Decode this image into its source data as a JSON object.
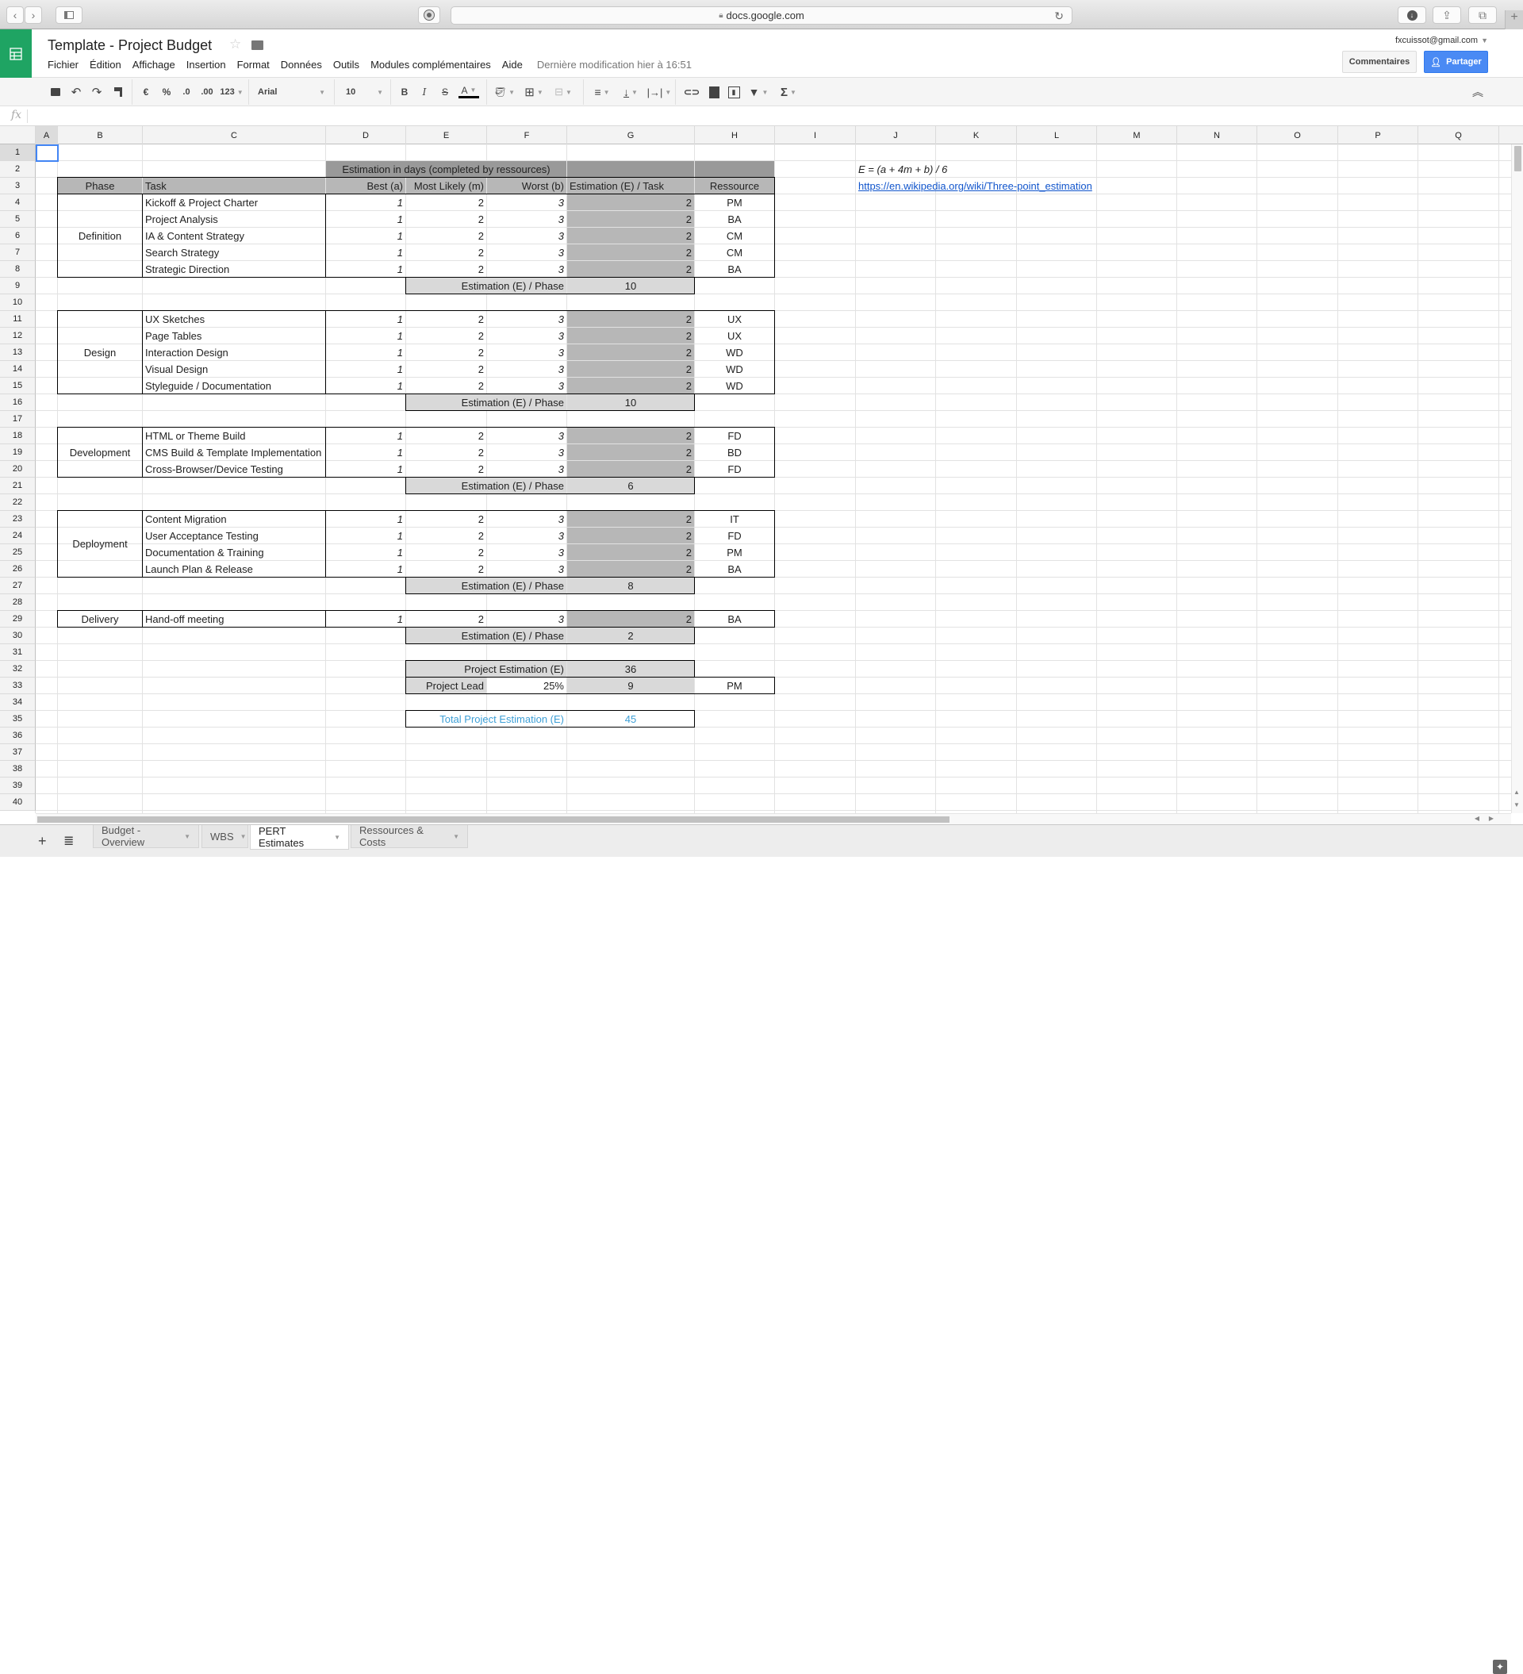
{
  "browser": {
    "address": "docs.google.com",
    "back_icon": "chevron-left-icon",
    "forward_icon": "chevron-right-icon"
  },
  "app": {
    "title": "Template - Project Budget",
    "menu": [
      "Fichier",
      "Édition",
      "Affichage",
      "Insertion",
      "Format",
      "Données",
      "Outils",
      "Modules complémentaires",
      "Aide"
    ],
    "last_modified": "Dernière modification hier à 16:51",
    "account": "fxcuissot@gmail.com",
    "comments_label": "Commentaires",
    "share_label": "Partager",
    "accent_color": "#4a8af4",
    "brand_color": "#1fa463"
  },
  "toolbar": {
    "currency": "€",
    "percent": "%",
    "decrease_decimals": ".0",
    "increase_decimals": ".00",
    "number_format": "123",
    "font": "Arial",
    "font_size": "10",
    "bold": "B",
    "italic": "I",
    "strike": "S",
    "text_color": "A",
    "sum": "Σ"
  },
  "formula_bar": {
    "fx": "fx",
    "value": ""
  },
  "columns": [
    "A",
    "B",
    "C",
    "D",
    "E",
    "F",
    "G",
    "H",
    "I",
    "J",
    "K",
    "L",
    "M",
    "N",
    "O",
    "P",
    "Q"
  ],
  "rows": [
    "1",
    "2",
    "3",
    "4",
    "5",
    "6",
    "7",
    "8",
    "9",
    "10",
    "11",
    "12",
    "13",
    "14",
    "15",
    "16",
    "17",
    "18",
    "19",
    "20",
    "21",
    "22",
    "23",
    "24",
    "25",
    "26",
    "27",
    "28",
    "29",
    "30",
    "31",
    "32",
    "33",
    "34",
    "35",
    "36",
    "37",
    "38",
    "39",
    "40"
  ],
  "sheet": {
    "group_header": "Estimation in days (completed by ressources)",
    "headers": {
      "phase": "Phase",
      "task": "Task",
      "best": "Best (a)",
      "likely": "Most Likely (m)",
      "worst": "Worst (b)",
      "estimation": "Estimation (E) / Task",
      "resource": "Ressource"
    },
    "formula": "E = (a + 4m + b) / 6",
    "link": "https://en.wikipedia.org/wiki/Three-point_estimation",
    "phase_total_label": "Estimation (E) / Phase",
    "phases": [
      {
        "name": "Definition",
        "total": "10",
        "tasks": [
          {
            "task": "Kickoff & Project Charter",
            "a": "1",
            "m": "2",
            "b": "3",
            "e": "2",
            "res": "PM"
          },
          {
            "task": "Project Analysis",
            "a": "1",
            "m": "2",
            "b": "3",
            "e": "2",
            "res": "BA"
          },
          {
            "task": "IA & Content Strategy",
            "a": "1",
            "m": "2",
            "b": "3",
            "e": "2",
            "res": "CM"
          },
          {
            "task": "Search Strategy",
            "a": "1",
            "m": "2",
            "b": "3",
            "e": "2",
            "res": "CM"
          },
          {
            "task": "Strategic Direction",
            "a": "1",
            "m": "2",
            "b": "3",
            "e": "2",
            "res": "BA"
          }
        ]
      },
      {
        "name": "Design",
        "total": "10",
        "tasks": [
          {
            "task": "UX Sketches",
            "a": "1",
            "m": "2",
            "b": "3",
            "e": "2",
            "res": "UX"
          },
          {
            "task": "Page Tables",
            "a": "1",
            "m": "2",
            "b": "3",
            "e": "2",
            "res": "UX"
          },
          {
            "task": "Interaction Design",
            "a": "1",
            "m": "2",
            "b": "3",
            "e": "2",
            "res": "WD"
          },
          {
            "task": "Visual Design",
            "a": "1",
            "m": "2",
            "b": "3",
            "e": "2",
            "res": "WD"
          },
          {
            "task": "Styleguide / Documentation",
            "a": "1",
            "m": "2",
            "b": "3",
            "e": "2",
            "res": "WD"
          }
        ]
      },
      {
        "name": "Development",
        "total": "6",
        "tasks": [
          {
            "task": "HTML or Theme Build",
            "a": "1",
            "m": "2",
            "b": "3",
            "e": "2",
            "res": "FD"
          },
          {
            "task": "CMS Build & Template Implementation",
            "a": "1",
            "m": "2",
            "b": "3",
            "e": "2",
            "res": "BD"
          },
          {
            "task": "Cross-Browser/Device Testing",
            "a": "1",
            "m": "2",
            "b": "3",
            "e": "2",
            "res": "FD"
          }
        ]
      },
      {
        "name": "Deployment",
        "total": "8",
        "tasks": [
          {
            "task": "Content Migration",
            "a": "1",
            "m": "2",
            "b": "3",
            "e": "2",
            "res": "IT"
          },
          {
            "task": "User Acceptance Testing",
            "a": "1",
            "m": "2",
            "b": "3",
            "e": "2",
            "res": "FD"
          },
          {
            "task": "Documentation & Training",
            "a": "1",
            "m": "2",
            "b": "3",
            "e": "2",
            "res": "PM"
          },
          {
            "task": "Launch Plan & Release",
            "a": "1",
            "m": "2",
            "b": "3",
            "e": "2",
            "res": "BA"
          }
        ]
      },
      {
        "name": "Delivery",
        "total": "2",
        "tasks": [
          {
            "task": "Hand-off meeting",
            "a": "1",
            "m": "2",
            "b": "3",
            "e": "2",
            "res": "BA"
          }
        ]
      }
    ],
    "project_estimation_label": "Project Estimation (E)",
    "project_estimation": "36",
    "project_lead_label": "Project Lead",
    "project_lead_pct": "25%",
    "project_lead_value": "9",
    "project_lead_resource": "PM",
    "total_label": "Total Project Estimation (E)",
    "total_value": "45",
    "total_color": "#3d9fd6"
  },
  "tabs": [
    {
      "label": "Budget - Overview",
      "active": false
    },
    {
      "label": "WBS",
      "active": false
    },
    {
      "label": "PERT Estimates",
      "active": true
    },
    {
      "label": "Ressources & Costs",
      "active": false
    }
  ]
}
